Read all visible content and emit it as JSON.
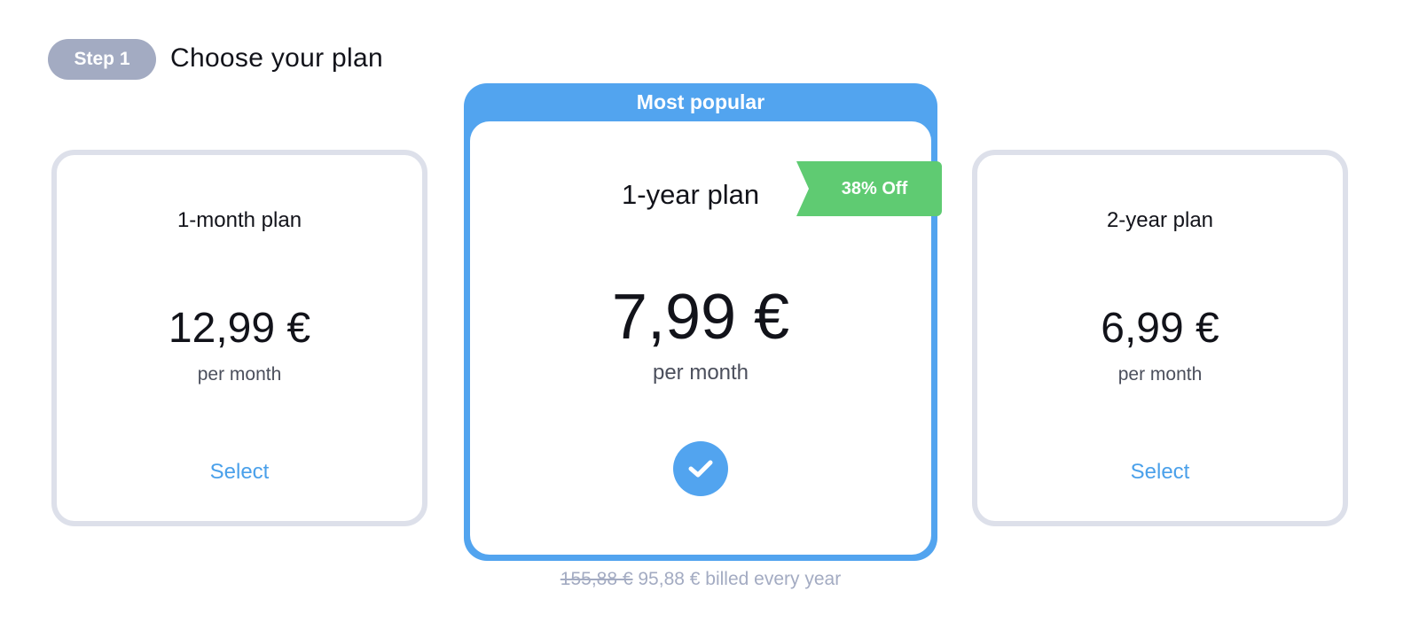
{
  "step": {
    "badge": "Step 1",
    "title": "Choose your plan"
  },
  "plans": [
    {
      "name": "1-month plan",
      "price": "12,99 €",
      "period": "per month",
      "action": "Select"
    },
    {
      "name": "1-year plan",
      "price": "7,99 €",
      "period": "per month",
      "ribbon": "Most popular",
      "discount": "38% Off",
      "selected": true
    },
    {
      "name": "2-year plan",
      "price": "6,99 €",
      "period": "per month",
      "action": "Select"
    }
  ],
  "billing": {
    "old_price": "155,88 €",
    "new_price": "95,88 €",
    "suffix": "billed every year"
  },
  "colors": {
    "accent": "#52a4ef",
    "discount": "#5fcb72",
    "step_badge": "#a3abc2",
    "card_border": "#dde0ea"
  },
  "icons": {
    "selected": "check-icon"
  }
}
